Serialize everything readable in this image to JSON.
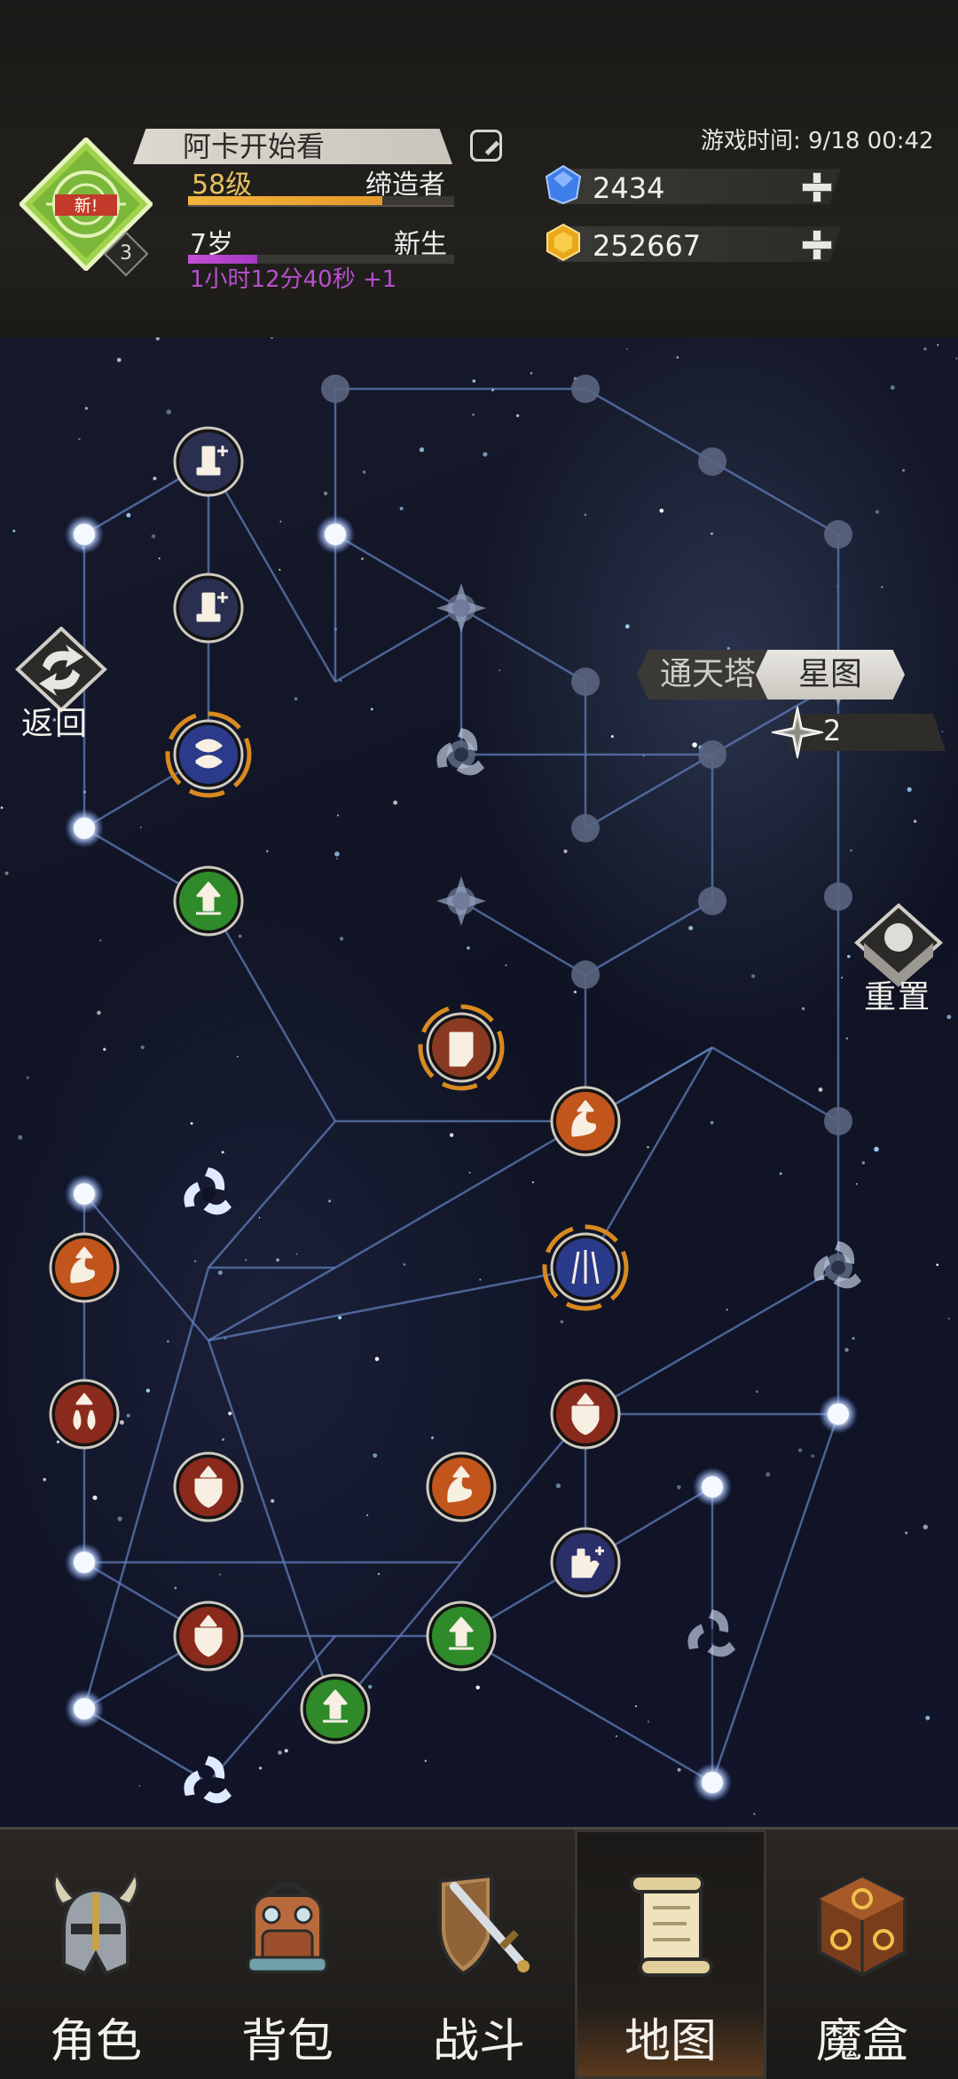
{
  "header": {
    "badge_text": "新!",
    "badge_level": "3",
    "player_name": "阿卡开始看",
    "level": "58级",
    "title": "缔造者",
    "level_progress": 0.73,
    "age": "7岁",
    "life_stage": "新生",
    "age_progress": 0.26,
    "timer": "1小时12分40秒 +1",
    "game_time": "游戏时间: 9/18 00:42",
    "gems": "2434",
    "gold": "252667"
  },
  "controls": {
    "back_label": "返回",
    "tower_tab": "通天塔",
    "starmap_tab": "星图",
    "star_points": "2",
    "reset_label": "重置"
  },
  "starmap": {
    "skill_nodes": [
      {
        "name": "skill-sword-plus",
        "type": "sword-plus",
        "color": "#2a2f52"
      },
      {
        "name": "skill-sword-plus-2",
        "type": "sword-plus",
        "color": "#2a2f52"
      },
      {
        "name": "skill-chain-rune",
        "type": "chain",
        "color": "#2b3a8a"
      },
      {
        "name": "skill-green-up",
        "type": "up",
        "color": "#2f8a2a"
      },
      {
        "name": "skill-fist",
        "type": "fist",
        "color": "#8a3a22"
      },
      {
        "name": "skill-flame-up",
        "type": "flame-up",
        "color": "#c2551c"
      },
      {
        "name": "skill-claw-rune",
        "type": "claw",
        "color": "#2a3a8a"
      },
      {
        "name": "skill-flame-up-left",
        "type": "flame-up",
        "color": "#c2551c"
      },
      {
        "name": "skill-drops-up",
        "type": "drops-up",
        "color": "#8a2a1c"
      },
      {
        "name": "skill-shield-up",
        "type": "shield-up",
        "color": "#8a2a1c"
      },
      {
        "name": "skill-shield-up-2",
        "type": "shield-up",
        "color": "#8a2a1c"
      },
      {
        "name": "skill-flame-up-2",
        "type": "flame-up",
        "color": "#c2551c"
      },
      {
        "name": "skill-hand-plus",
        "type": "hand-plus",
        "color": "#2a2f6a"
      },
      {
        "name": "skill-shield-up-3",
        "type": "shield-up",
        "color": "#8a2a1c"
      },
      {
        "name": "skill-green-up-2",
        "type": "up",
        "color": "#2f8a2a"
      },
      {
        "name": "skill-green-up-3",
        "type": "up",
        "color": "#2f8a2a"
      }
    ]
  },
  "nav": [
    {
      "label": "角色",
      "icon": "helmet-icon"
    },
    {
      "label": "背包",
      "icon": "backpack-icon"
    },
    {
      "label": "战斗",
      "icon": "sword-shield-icon"
    },
    {
      "label": "地图",
      "icon": "scroll-map-icon",
      "active": true
    },
    {
      "label": "魔盒",
      "icon": "magic-box-icon"
    }
  ],
  "colors": {
    "accent_gold": "#e8c25c",
    "level_bar": "#f2b43c",
    "age_bar": "#c64fd6",
    "node_glow": "#dbe8ff",
    "edge": "#5f7db8"
  }
}
